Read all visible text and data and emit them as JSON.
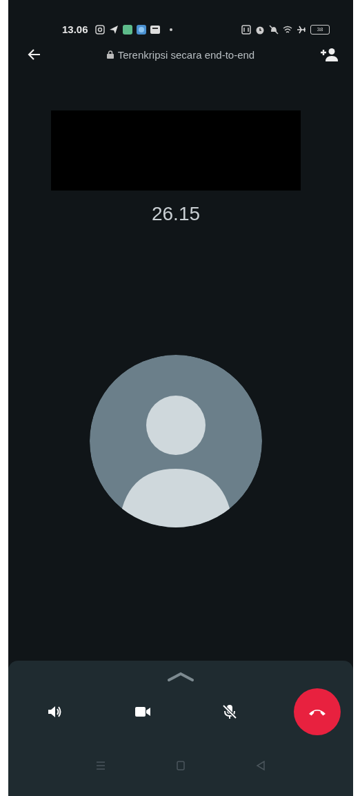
{
  "status_bar": {
    "time": "13.06",
    "battery": "38"
  },
  "header": {
    "encryption_note": "Terenkripsi secara end-to-end"
  },
  "call": {
    "duration": "26.15"
  },
  "controls": [
    {
      "kind": "speaker"
    },
    {
      "kind": "video"
    },
    {
      "kind": "mic",
      "muted": true
    },
    {
      "kind": "end"
    }
  ]
}
